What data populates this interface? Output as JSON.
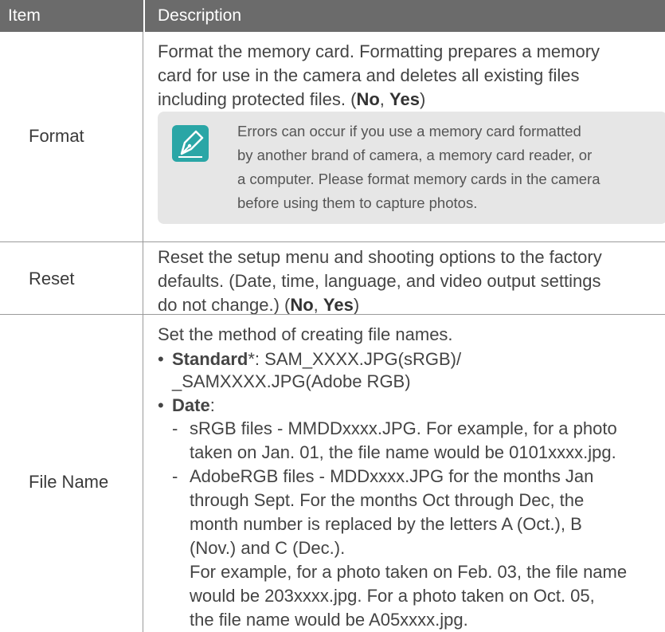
{
  "header": {
    "item": "Item",
    "description": "Description"
  },
  "rows": [
    {
      "item": "Format",
      "desc_lines": [
        "Format the memory card. Formatting prepares a memory",
        "card for use in the camera and deletes all existing files",
        "including protected files. "
      ],
      "options_prefix": "(",
      "opt1": "No",
      "sep": ", ",
      "opt2": "Yes",
      "options_suffix": ")",
      "note": [
        "Errors can occur if you use a memory card formatted",
        "by another brand of camera, a memory card reader, or",
        "a computer. Please format memory cards in the camera",
        "before using them to capture photos."
      ]
    },
    {
      "item": "Reset",
      "desc_lines": [
        "Reset the setup menu and shooting options to the factory",
        "defaults. (Date, time, language, and video output settings",
        "do not change.) "
      ],
      "options_prefix": "(",
      "opt1": "No",
      "sep": ", ",
      "opt2": "Yes",
      "options_suffix": ")"
    },
    {
      "item": "File Name",
      "intro": "Set the method of creating file names.",
      "standard_label": "Standard",
      "standard_rest1": "*: SAM_XXXX.JPG(sRGB)/",
      "standard_rest2": "_SAMXXXX.JPG(Adobe RGB)",
      "date_label": "Date",
      "date_colon": ":",
      "srgb_lines": [
        "sRGB files - MMDDxxxx.JPG. For example, for a photo",
        "taken on Jan. 01, the file name would be 0101xxxx.jpg."
      ],
      "adobe_lines": [
        "AdobeRGB files - MDDxxxx.JPG for the months Jan",
        "through Sept. For the months Oct through Dec, the",
        "month number is replaced by the letters A (Oct.), B",
        "(Nov.) and C (Dec.).",
        "For example, for a photo taken on Feb. 03, the file name",
        "would be 203xxxx.jpg. For a photo taken on Oct. 05,",
        "the file name would be A05xxxx.jpg."
      ],
      "dash": "-",
      "bullet": "•"
    }
  ],
  "colors": {
    "header_bg": "#6b6b6b",
    "note_bg": "#e6e6e6",
    "icon_accent": "#2aa6a6"
  },
  "icons": {
    "note": "pen-nib-icon"
  }
}
